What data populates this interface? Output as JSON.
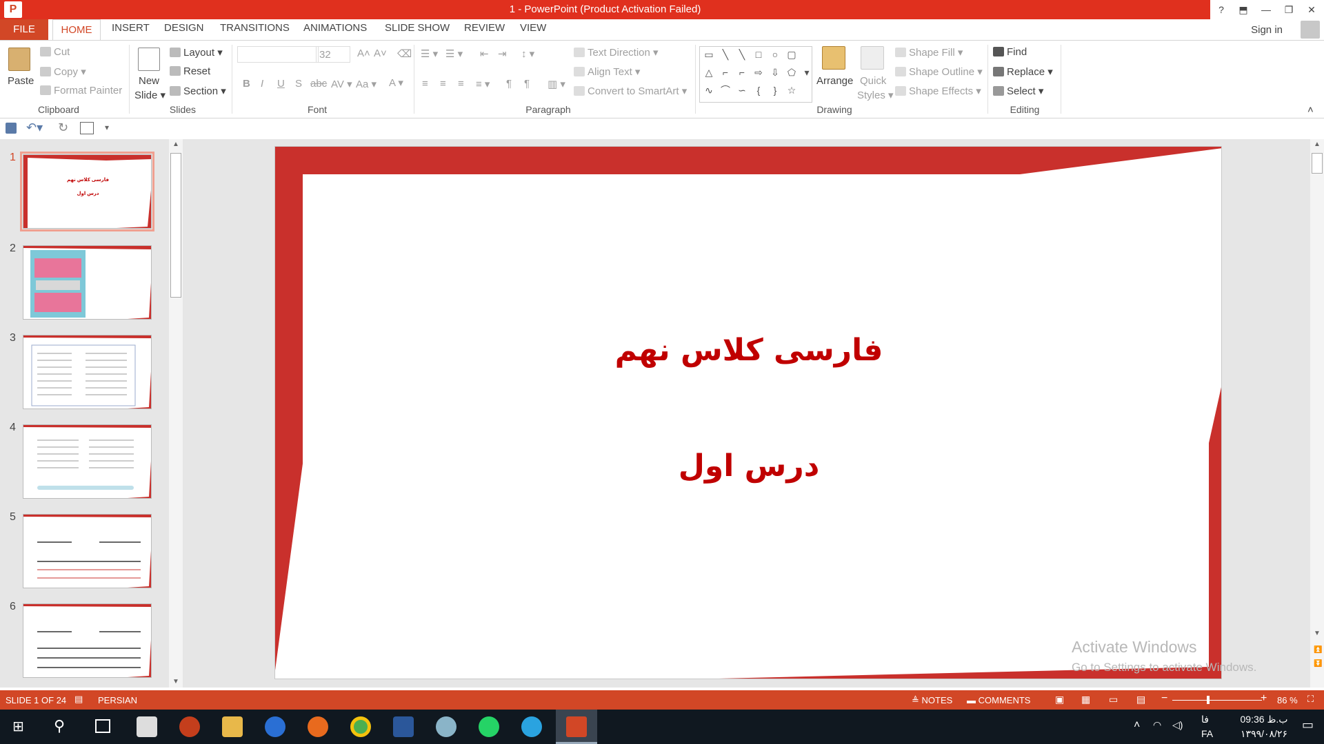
{
  "window": {
    "title": "1 -  PowerPoint (Product Activation Failed)",
    "help": "?",
    "buttons": [
      "?",
      "⬒",
      "—",
      "❐",
      "✕"
    ]
  },
  "tabs": {
    "file": "FILE",
    "items": [
      "HOME",
      "INSERT",
      "DESIGN",
      "TRANSITIONS",
      "ANIMATIONS",
      "SLIDE SHOW",
      "REVIEW",
      "VIEW"
    ],
    "sign_in": "Sign in"
  },
  "ribbon": {
    "clipboard": {
      "paste": "Paste",
      "cut": "Cut",
      "copy": "Copy",
      "format_painter": "Format Painter",
      "label": "Clipboard"
    },
    "slides": {
      "new_slide_1": "New",
      "new_slide_2": "Slide",
      "layout": "Layout",
      "reset": "Reset",
      "section": "Section",
      "label": "Slides"
    },
    "font": {
      "font_size": "32",
      "label": "Font"
    },
    "paragraph": {
      "text_direction": "Text Direction",
      "align_text": "Align Text",
      "convert_smartart": "Convert to SmartArt",
      "label": "Paragraph"
    },
    "drawing": {
      "arrange": "Arrange",
      "quick_styles_1": "Quick",
      "quick_styles_2": "Styles",
      "shape_fill": "Shape Fill",
      "shape_outline": "Shape Outline",
      "shape_effects": "Shape Effects",
      "label": "Drawing"
    },
    "editing": {
      "find": "Find",
      "replace": "Replace",
      "select": "Select",
      "label": "Editing"
    }
  },
  "thumbnails": {
    "numbers": [
      "1",
      "2",
      "3",
      "4",
      "5",
      "6"
    ],
    "thumb1_title": "فارسی کلاس نهم",
    "thumb1_sub": "درس اول"
  },
  "slide": {
    "title": "فارسی کلاس نهم",
    "subtitle": "درس اول"
  },
  "watermark": {
    "line1": "Activate Windows",
    "line2": "Go to Settings to activate Windows."
  },
  "statusbar": {
    "slide_count": "SLIDE 1 OF 24",
    "language": "PERSIAN",
    "notes": "NOTES",
    "comments": "COMMENTS",
    "zoom": "86 %"
  },
  "taskbar": {
    "time": "09:36 ب.ظ",
    "date": "۱۳۹۹/۰۸/۲۶",
    "lang_fa": "فا",
    "lang_code": "FA"
  },
  "colors": {
    "accent": "#d24726",
    "title_bar": "#e0301e",
    "slide_frame": "#c9302c",
    "slide_text": "#c00000"
  }
}
